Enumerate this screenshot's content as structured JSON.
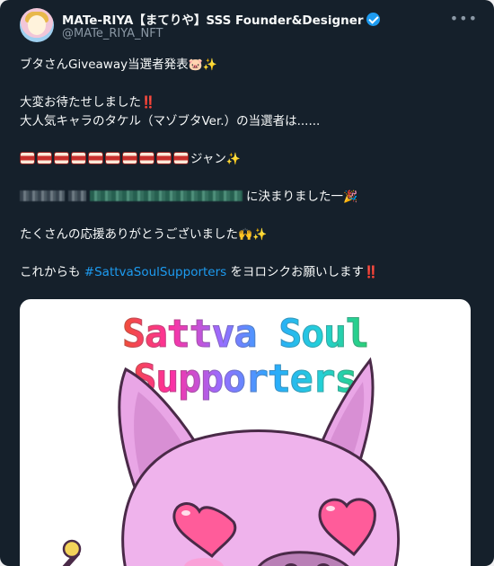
{
  "account": {
    "name": "MATe-RIYA【まてりや】SSS Founder&Designer",
    "handle": "@MATe_RIYA_NFT"
  },
  "tweet": {
    "line1": "ブタさんGiveaway当選者発表",
    "line2": "大変お待たせしました",
    "line3": "大人気キャラのタケル（マゾブタVer.）の当選者は......",
    "line4_suffix": "ジャン",
    "line5_suffix": "に決まりました一",
    "line6": "たくさんの応援ありがとうございました",
    "line7_prefix": "これからも ",
    "hashtag": "#SattvaSoulSupporters",
    "line7_suffix": " をヨロシクお願いします"
  },
  "media": {
    "banner_text": "Sattva Soul Supporters"
  },
  "icons": [
    "verified-badge-icon",
    "more-icon",
    "pig-emoji",
    "sparkles-emoji",
    "double-exclamation-emoji",
    "drum-emoji",
    "party-popper-emoji",
    "raised-hands-emoji"
  ],
  "colors": {
    "background": "#15202b",
    "text": "#f7f9f9",
    "secondary_text": "#8b98a5",
    "accent": "#1d9bf0",
    "verified": "#1d9bf0",
    "pig_pink": "#e9a6e6",
    "heart_pink": "#ff5c9a"
  }
}
